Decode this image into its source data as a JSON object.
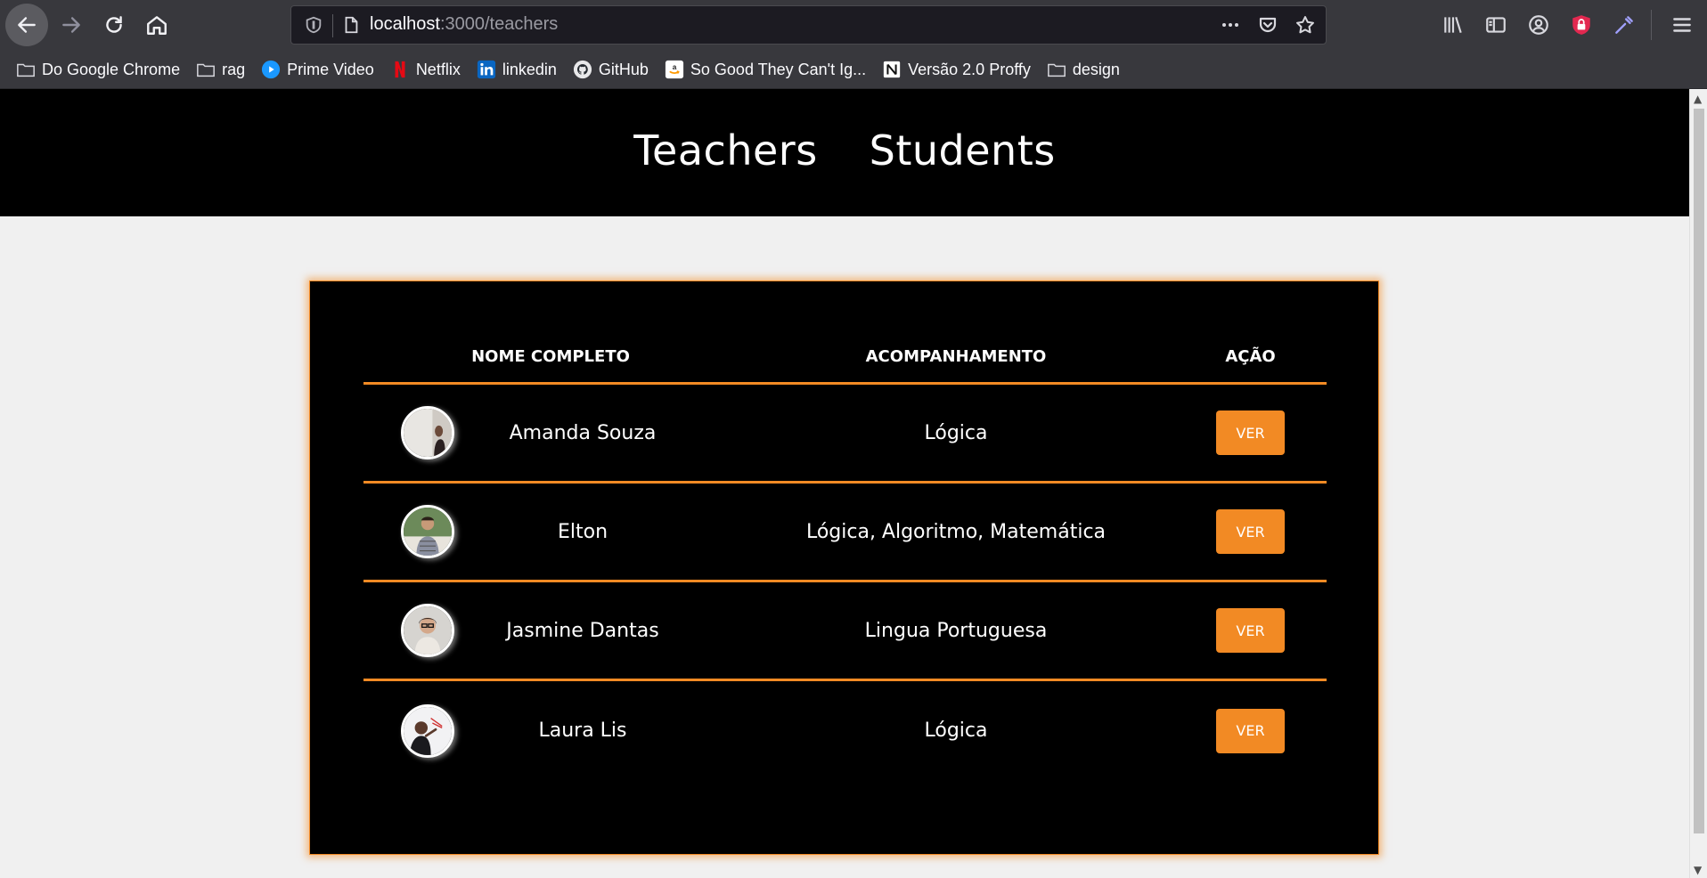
{
  "browser": {
    "url_host": "localhost",
    "url_path": ":3000/teachers",
    "bookmarks": [
      {
        "label": "Do Google Chrome",
        "icon": "folder-icon"
      },
      {
        "label": "rag",
        "icon": "folder-icon"
      },
      {
        "label": "Prime Video",
        "icon": "prime-video-icon"
      },
      {
        "label": "Netflix",
        "icon": "netflix-icon"
      },
      {
        "label": "linkedin",
        "icon": "linkedin-icon"
      },
      {
        "label": "GitHub",
        "icon": "github-icon"
      },
      {
        "label": "So Good They Can't Ig...",
        "icon": "amazon-icon"
      },
      {
        "label": "Versão 2.0 Proffy",
        "icon": "notion-icon"
      },
      {
        "label": "design",
        "icon": "folder-icon"
      }
    ]
  },
  "header": {
    "nav": [
      {
        "label": "Teachers"
      },
      {
        "label": "Students"
      }
    ]
  },
  "table": {
    "columns": [
      "NOME COMPLETO",
      "ACOMPANHAMENTO",
      "AÇÃO"
    ],
    "rows": [
      {
        "name": "Amanda Souza",
        "acompanhamento": "Lógica",
        "action": "VER"
      },
      {
        "name": "Elton",
        "acompanhamento": "Lógica, Algoritmo, Matemática",
        "action": "VER"
      },
      {
        "name": "Jasmine Dantas",
        "acompanhamento": "Lingua Portuguesa",
        "action": "VER"
      },
      {
        "name": "Laura Lis",
        "acompanhamento": "Lógica",
        "action": "VER"
      }
    ]
  },
  "colors": {
    "accent": "#f28a24",
    "header_bg": "#000000",
    "page_bg": "#f0f0f0"
  }
}
